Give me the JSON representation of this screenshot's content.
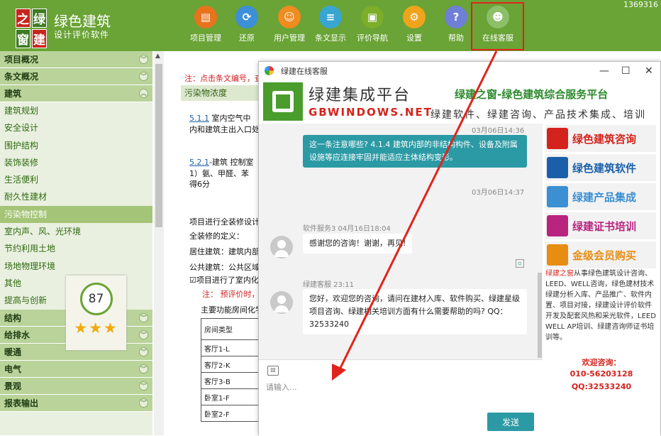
{
  "header": {
    "logo_chars": [
      "之",
      "绿",
      "窗",
      "建"
    ],
    "title": "绿色建筑",
    "subtitle": "设计评价软件",
    "corner_number": "1369316"
  },
  "toolbar": [
    {
      "label": "项目管理",
      "icon": "project-icon",
      "color": "#e8731c"
    },
    {
      "label": "还原",
      "icon": "restore-icon",
      "color": "#3d8fd6"
    },
    {
      "label": "用户管理",
      "icon": "user-icon",
      "color": "#ef8b1f"
    },
    {
      "label": "条文显示",
      "icon": "clause-icon",
      "color": "#39a6d2"
    },
    {
      "label": "评价导航",
      "icon": "nav-icon",
      "color": "#7cae2a"
    },
    {
      "label": "设置",
      "icon": "gear-icon",
      "color": "#f0a41b"
    },
    {
      "label": "帮助",
      "icon": "help-icon",
      "color": "#6f7fd6"
    },
    {
      "label": "在线客服",
      "icon": "service-icon",
      "color": "#6fa24a"
    }
  ],
  "sidebar": {
    "sections_top": [
      "项目概况",
      "条文概况",
      "建筑"
    ],
    "items": [
      "建筑规划",
      "安全设计",
      "围护结构",
      "装饰装修",
      "生活便利",
      "耐久性建材",
      "污染物控制",
      "室内声、风、光环境",
      "节约利用土地",
      "场地物理环境",
      "其他",
      "提高与创新"
    ],
    "selected": "污染物控制",
    "sections_bottom": [
      "结构",
      "给排水",
      "暖通",
      "电气",
      "景观",
      "报表输出"
    ],
    "score": "87",
    "stars": "★★★"
  },
  "main": {
    "note": "注：点击条文编号，查",
    "section": "污染物浓度",
    "p1_code": "5.1.1",
    "p1a": " 室内空气中",
    "p1b": "内和建筑主出入口处",
    "p2_code": "5.2.1",
    "p2a": "-建筑 控制室",
    "p2b": "  1）氨、甲醛、苯",
    "p2c": "得6分",
    "lines": [
      "项目进行全装修设计",
      "全装修的定义：",
      "居住建筑：建筑内部",
      "公共建筑：公共区域",
      "项目进行了室内化",
      "注： 预评价时，",
      "主要功能房间化学"
    ],
    "table_header": "房间类型",
    "table_rows": [
      "客厅1-L",
      "客厅2-K",
      "客厅3-B",
      "卧室1-F",
      "卧室2-F"
    ]
  },
  "chat_window": {
    "title": "绿建在线客服",
    "brand_cn": "绿建集成平台",
    "brand_en": "GBWINDOWS.NET",
    "slogan1": "绿建之窗-绿色建筑综合服务平台",
    "slogan2": "绿建软件、绿建咨询、产品技术集成、培训",
    "messages": [
      {
        "time": "03月06日14:36",
        "text": "这一条注意哪些? 4.1.4 建筑内部的非结构构件、设备及附属设施等应连接牢固并能适应主体结构变形。"
      },
      {
        "time": "03月06日14:37",
        "text": ""
      },
      {
        "sender": "软件服务3 04月16日18:04",
        "text": "感谢您的咨询！谢谢，再见!"
      },
      {
        "sender": "绿建客服 23:11",
        "text": "您好，欢迎您的咨询，请问在建材入库、软件购买、绿建星级项目咨询、绿建相关培训方面有什么需要帮助的吗? QQ：32533240"
      }
    ],
    "input_placeholder": "请输入...",
    "send_label": "发送",
    "ads": [
      "绿色建筑咨询",
      "绿色建筑软件",
      "绿建产品集成",
      "绿建证书培训",
      "金级会员购买"
    ],
    "desc_brand": "绿建之窗",
    "desc_text": "从事绿色建筑设计咨询、LEED、WELL咨询，绿色建材技术绿建分析入库、产品推广、软件内置、项目对接，绿建设计评价软件开发及配套风热和采光软件，LEED WELL AP培训、绿建咨询师证书培训等。",
    "contact_label": "欢迎咨询：",
    "phone": "010-56203128",
    "qq": "QQ:32533240"
  }
}
